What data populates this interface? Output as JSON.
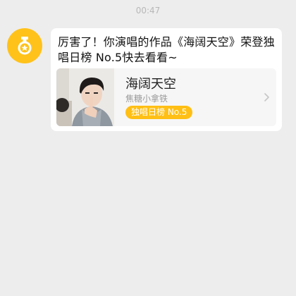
{
  "chat": {
    "timestamp": "00:47",
    "avatar_icon": "medal-icon",
    "message_text": "厉害了！你演唱的作品《海阔天空》荣登独唱日榜 No.5快去看看~"
  },
  "song_card": {
    "title": "海阔天空",
    "artist": "焦糖小拿铁",
    "rank_badge": "独唱日榜 No.5",
    "chevron_icon": "chevron-right-icon",
    "cover_icon": "singer-photo"
  },
  "colors": {
    "accent": "#ffc21a",
    "background": "#ededed",
    "bubble": "#ffffff",
    "card": "#f6f6f6"
  }
}
